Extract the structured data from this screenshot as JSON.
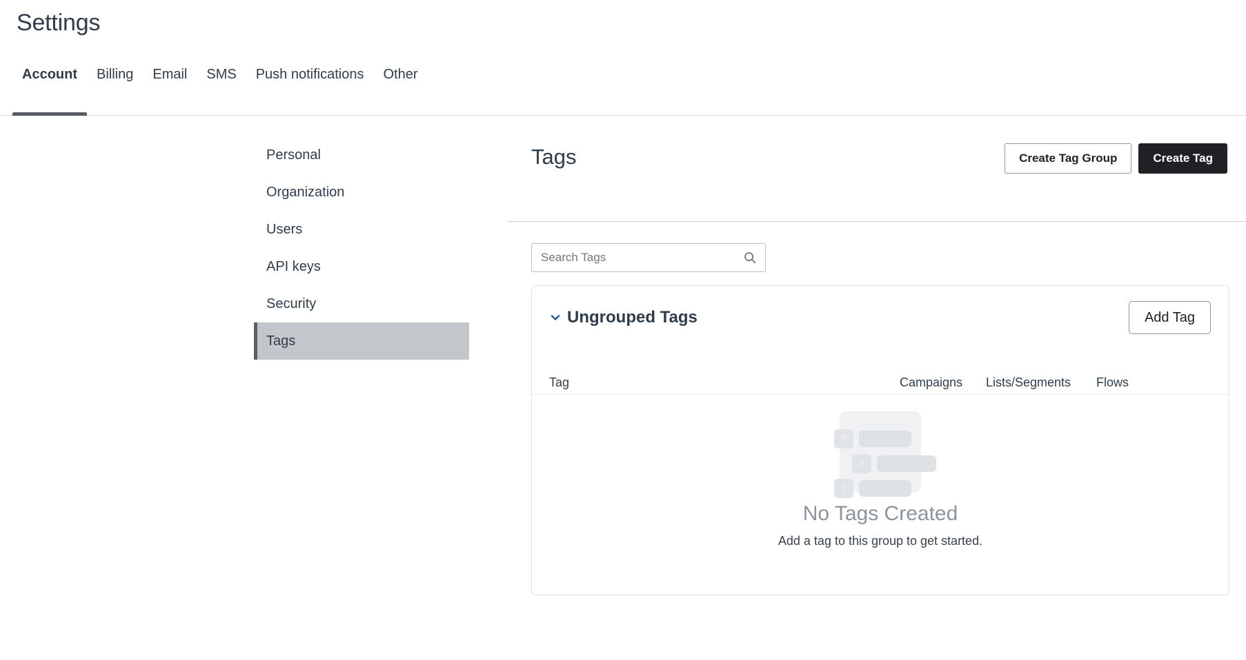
{
  "page": {
    "title": "Settings"
  },
  "tabs": [
    {
      "label": "Account",
      "active": true
    },
    {
      "label": "Billing",
      "active": false
    },
    {
      "label": "Email",
      "active": false
    },
    {
      "label": "SMS",
      "active": false
    },
    {
      "label": "Push notifications",
      "active": false
    },
    {
      "label": "Other",
      "active": false
    }
  ],
  "settings_nav": [
    {
      "label": "Personal",
      "active": false
    },
    {
      "label": "Organization",
      "active": false
    },
    {
      "label": "Users",
      "active": false
    },
    {
      "label": "API keys",
      "active": false
    },
    {
      "label": "Security",
      "active": false
    },
    {
      "label": "Tags",
      "active": true
    }
  ],
  "main": {
    "title": "Tags",
    "actions": {
      "create_tag_group": "Create Tag Group",
      "create_tag": "Create Tag"
    },
    "search": {
      "placeholder": "Search Tags",
      "value": "",
      "icon": "search-icon"
    },
    "group": {
      "title": "Ungrouped Tags",
      "expanded": true,
      "chevron_icon": "chevron-down-icon",
      "add_tag_label": "Add Tag",
      "columns": [
        "Tag",
        "Campaigns",
        "Lists/Segments",
        "Flows"
      ],
      "rows": [],
      "empty_state": {
        "title": "No Tags Created",
        "subtitle": "Add a tag to this group to get started.",
        "illustration_badge_glyph": "?"
      }
    }
  },
  "colors": {
    "text_primary": "#2f3d4a",
    "primary_button_bg": "#1f2124",
    "chevron_blue": "#2a5b94",
    "active_nav_bg": "#c3c7cc",
    "active_nav_accent": "#5a6066",
    "active_tab_underline": "#565c62",
    "empty_title": "#8d949c"
  }
}
